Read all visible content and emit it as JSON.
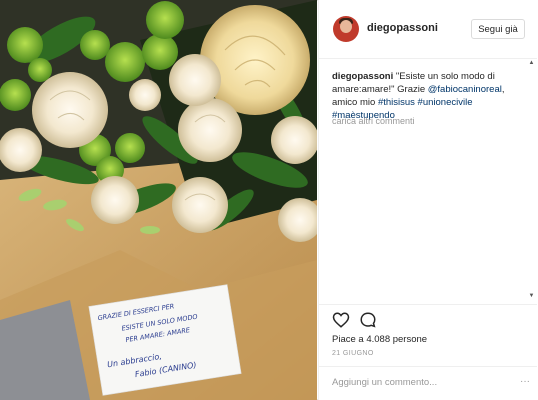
{
  "post": {
    "username": "diegopassoni",
    "follow_label": "Segui già",
    "caption": {
      "username": "diegopassoni",
      "text_1": " \"Esiste un solo modo di amare:amare!\" Grazie ",
      "mention": "@fabiocaninoreal",
      "text_2": ", amico mio ",
      "hashtag_1": "#thisisus",
      "hashtag_2": "#unionecivile",
      "hashtag_3": "#maèstupendo"
    },
    "load_more_comments": "carica altri commenti",
    "likes": "Piace a 4.088 persone",
    "date": "21 GIUGNO",
    "comment_placeholder": "Aggiungi un commento...",
    "more_options": "···"
  },
  "photo": {
    "note_lines": [
      "GRAZIE DI ESSERCI PER",
      "ESISTE UN SOLO MODO",
      "PER AMARE: AMARE",
      "Un abbraccio,",
      "Fabio (CANINO)"
    ]
  },
  "icons": {
    "like": "heart-icon",
    "comment": "comment-icon",
    "avatar": "avatar-icon"
  },
  "colors": {
    "link": "#003569",
    "secondary_text": "#999999",
    "border": "#dbdbdb",
    "text": "#262626"
  }
}
